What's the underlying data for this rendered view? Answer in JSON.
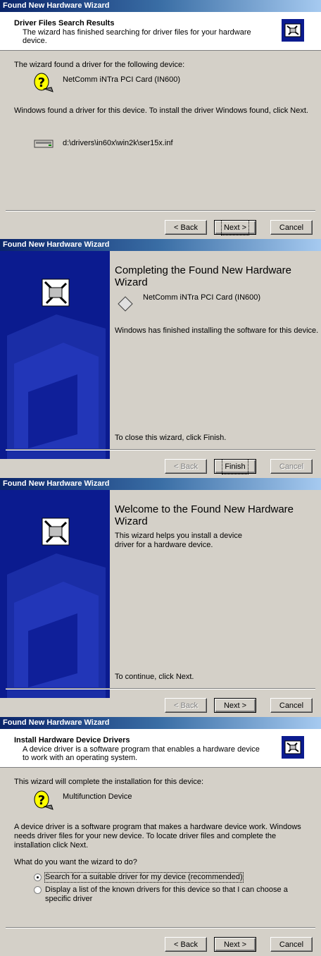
{
  "panel1": {
    "title": "Found New Hardware Wizard",
    "header_title": "Driver Files Search Results",
    "header_subtitle": "The wizard has finished searching for driver files for your hardware device.",
    "found_text": "The wizard found a driver for the following device:",
    "device_name": "NetComm iNTra PCI Card (IN600)",
    "instruction": "Windows found a driver for this device. To install the driver Windows found, click Next.",
    "driver_path": "d:\\drivers\\in60x\\win2k\\ser15x.inf",
    "back_label": "< Back",
    "next_label": "Next >",
    "cancel_label": "Cancel"
  },
  "panel2": {
    "title": "Found New Hardware Wizard",
    "heading": "Completing the Found New Hardware Wizard",
    "device_name": "NetComm iNTra PCI Card (IN600)",
    "status_text": "Windows has finished installing the software for this device.",
    "close_text": "To close this wizard, click Finish.",
    "back_label": "< Back",
    "finish_label": "Finish",
    "cancel_label": "Cancel"
  },
  "panel3": {
    "title": "Found New Hardware Wizard",
    "heading": "Welcome to the Found New Hardware Wizard",
    "intro_text": "This wizard helps you install a device driver for a hardware device.",
    "continue_text": "To continue, click Next.",
    "back_label": "< Back",
    "next_label": "Next >",
    "cancel_label": "Cancel"
  },
  "panel4": {
    "title": "Found New Hardware Wizard",
    "header_title": "Install Hardware Device Drivers",
    "header_subtitle": "A device driver is a software program that enables a hardware device to work with an operating system.",
    "complete_text": "This wizard will complete the installation for this device:",
    "device_name": "Multifunction Device",
    "description": "A device driver is a software program that makes a hardware device work. Windows needs driver files for your new device. To locate driver files and complete the installation click Next.",
    "question": "What do you want the wizard to do?",
    "option1": "Search for a suitable driver for my device (recommended)",
    "option2": "Display a list of the known drivers for this device so that I can choose a specific driver",
    "selected_option": "option1",
    "back_label": "< Back",
    "next_label": "Next >",
    "cancel_label": "Cancel"
  },
  "colors": {
    "dialog_bg": "#d4d0c8",
    "titlebar_start": "#0a246a",
    "titlebar_end": "#a6caf0",
    "side_panel": "#0b1b8f"
  }
}
